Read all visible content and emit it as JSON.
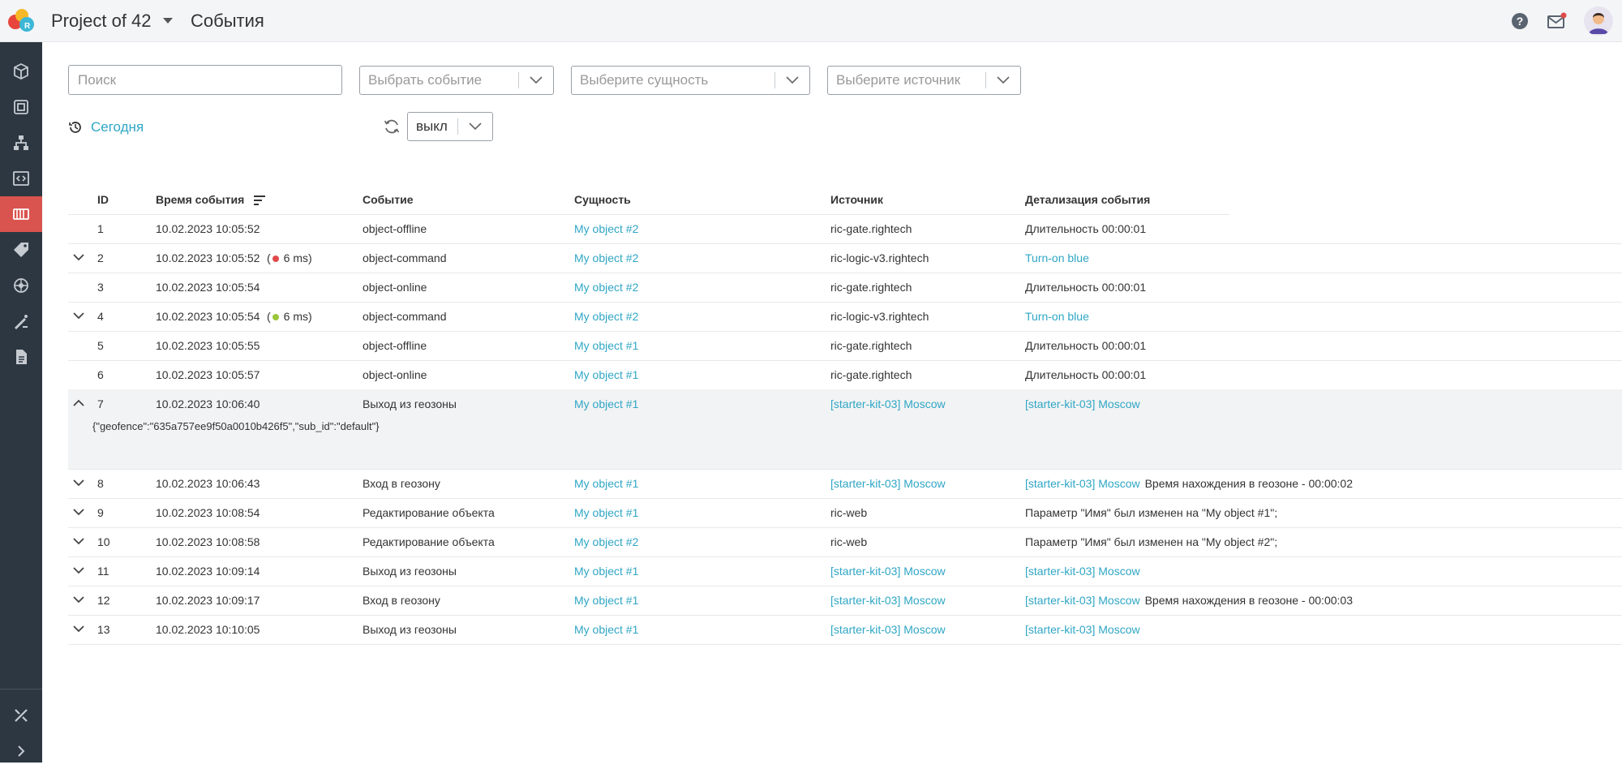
{
  "header": {
    "project_title": "Project of 42",
    "page_title": "События"
  },
  "colors": {
    "sidebar_bg": "#2d3741",
    "sidebar_active": "#d9534f",
    "link": "#2fa6c5",
    "status_red": "#e04a4a",
    "status_green": "#9bc63b"
  },
  "sidebar": {
    "icons": [
      "cube-icon",
      "frame-icon",
      "hierarchy-icon",
      "code-icon",
      "events-icon",
      "tag-icon",
      "globe-icon",
      "pen-ruler-icon",
      "document-icon",
      "tools-icon",
      "chevron-right-icon"
    ],
    "active_index": 4
  },
  "filters": {
    "search_placeholder": "Поиск",
    "event_placeholder": "Выбрать событие",
    "entity_placeholder": "Выберите сущность",
    "source_placeholder": "Выберите источник",
    "period_label": "Сегодня",
    "refresh_value": "выкл"
  },
  "table": {
    "columns": [
      "ID",
      "Время события",
      "Событие",
      "Сущность",
      "Источник",
      "Детализация события"
    ],
    "rows": [
      {
        "id": "1",
        "time": "10.02.2023 10:05:52",
        "event": "object-offline",
        "entity": "My object #2",
        "source": "ric-gate.rightech",
        "detail": "Длительность 00:00:01",
        "detail_link": false,
        "source_link": false,
        "chevron": "none"
      },
      {
        "id": "2",
        "time": "10.02.2023 10:05:52",
        "duration": "6 ms)",
        "status": "red",
        "event": "object-command",
        "entity": "My object #2",
        "source": "ric-logic-v3.rightech",
        "detail": "Turn-on blue",
        "detail_link": true,
        "source_link": false,
        "chevron": "down"
      },
      {
        "id": "3",
        "time": "10.02.2023 10:05:54",
        "event": "object-online",
        "entity": "My object #2",
        "source": "ric-gate.rightech",
        "detail": "Длительность 00:00:01",
        "detail_link": false,
        "source_link": false,
        "chevron": "none"
      },
      {
        "id": "4",
        "time": "10.02.2023 10:05:54",
        "duration": "6 ms)",
        "status": "green",
        "event": "object-command",
        "entity": "My object #2",
        "source": "ric-logic-v3.rightech",
        "detail": "Turn-on blue",
        "detail_link": true,
        "source_link": false,
        "chevron": "down"
      },
      {
        "id": "5",
        "time": "10.02.2023 10:05:55",
        "event": "object-offline",
        "entity": "My object #1",
        "source": "ric-gate.rightech",
        "detail": "Длительность 00:00:01",
        "detail_link": false,
        "source_link": false,
        "chevron": "none"
      },
      {
        "id": "6",
        "time": "10.02.2023 10:05:57",
        "event": "object-online",
        "entity": "My object #1",
        "source": "ric-gate.rightech",
        "detail": "Длительность 00:00:01",
        "detail_link": false,
        "source_link": false,
        "chevron": "none"
      },
      {
        "id": "7",
        "time": "10.02.2023 10:06:40",
        "event": "Выход из геозоны",
        "entity": "My object #1",
        "source": "[starter-kit-03] Moscow",
        "detail": "[starter-kit-03] Moscow",
        "detail_link": true,
        "source_link": true,
        "chevron": "up",
        "expanded": true,
        "json": "{\"geofence\":\"635a757ee9f50a0010b426f5\",\"sub_id\":\"default\"}"
      },
      {
        "id": "8",
        "time": "10.02.2023 10:06:43",
        "event": "Вход в геозону",
        "entity": "My object #1",
        "source": "[starter-kit-03] Moscow",
        "detail": "[starter-kit-03] Moscow",
        "detail_extra": "Время нахождения в геозоне - 00:00:02",
        "detail_link": true,
        "source_link": true,
        "chevron": "down"
      },
      {
        "id": "9",
        "time": "10.02.2023 10:08:54",
        "event": "Редактирование объекта",
        "entity": "My object #1",
        "source": "ric-web",
        "detail": "Параметр \"Имя\" был изменен на \"My object #1\";",
        "detail_link": false,
        "source_link": false,
        "chevron": "down"
      },
      {
        "id": "10",
        "time": "10.02.2023 10:08:58",
        "event": "Редактирование объекта",
        "entity": "My object #2",
        "source": "ric-web",
        "detail": "Параметр \"Имя\" был изменен на \"My object #2\";",
        "detail_link": false,
        "source_link": false,
        "chevron": "down"
      },
      {
        "id": "11",
        "time": "10.02.2023 10:09:14",
        "event": "Выход из геозоны",
        "entity": "My object #1",
        "source": "[starter-kit-03] Moscow",
        "detail": "[starter-kit-03] Moscow",
        "detail_link": true,
        "source_link": true,
        "chevron": "down"
      },
      {
        "id": "12",
        "time": "10.02.2023 10:09:17",
        "event": "Вход в геозону",
        "entity": "My object #1",
        "source": "[starter-kit-03] Moscow",
        "detail": "[starter-kit-03] Moscow",
        "detail_extra": "Время нахождения в геозоне - 00:00:03",
        "detail_link": true,
        "source_link": true,
        "chevron": "down"
      },
      {
        "id": "13",
        "time": "10.02.2023 10:10:05",
        "event": "Выход из геозоны",
        "entity": "My object #1",
        "source": "[starter-kit-03] Moscow",
        "detail": "[starter-kit-03] Moscow",
        "detail_link": true,
        "source_link": true,
        "chevron": "down"
      }
    ]
  }
}
